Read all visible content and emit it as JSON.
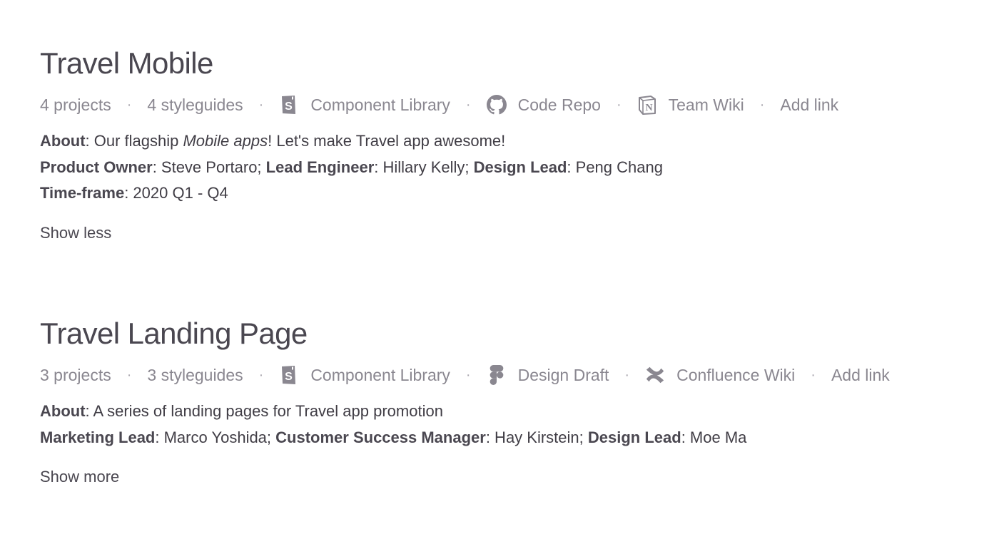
{
  "workspaces": [
    {
      "title": "Travel Mobile",
      "projects": "4 projects",
      "styleguides": "4 styleguides",
      "links": [
        {
          "label": "Component Library",
          "icon": "storybook-icon"
        },
        {
          "label": "Code Repo",
          "icon": "github-icon"
        },
        {
          "label": "Team Wiki",
          "icon": "notion-icon"
        }
      ],
      "add_link": "Add link",
      "about_label": "About",
      "about_pre": ": Our flagship ",
      "about_italic": "Mobile apps",
      "about_post": "! Let's make Travel app awesome!",
      "roles": [
        {
          "role": "Product Owner",
          "name": ": Steve Portaro; "
        },
        {
          "role": "Lead Engineer",
          "name": ": Hillary Kelly; "
        },
        {
          "role": "Design Lead",
          "name": ": Peng Chang"
        }
      ],
      "timeframe_label": "Time-frame",
      "timeframe_value": ": 2020 Q1 - Q4",
      "toggle": "Show less"
    },
    {
      "title": "Travel Landing Page",
      "projects": "3 projects",
      "styleguides": "3 styleguides",
      "links": [
        {
          "label": "Component Library",
          "icon": "storybook-icon"
        },
        {
          "label": "Design Draft",
          "icon": "figma-icon"
        },
        {
          "label": "Confluence Wiki",
          "icon": "confluence-icon"
        }
      ],
      "add_link": "Add link",
      "about_label": "About",
      "about_text": ": A series of landing pages for Travel app promotion",
      "roles": [
        {
          "role": "Marketing Lead",
          "name": ": Marco Yoshida; "
        },
        {
          "role": "Customer Success Manager",
          "name": ": Hay Kirstein; "
        },
        {
          "role": "Design Lead",
          "name": ": Moe Ma"
        }
      ],
      "toggle": "Show more"
    }
  ],
  "separator": "·",
  "colors": {
    "text": "#403d45",
    "muted": "#8a8790",
    "icon": "#8a8790"
  }
}
